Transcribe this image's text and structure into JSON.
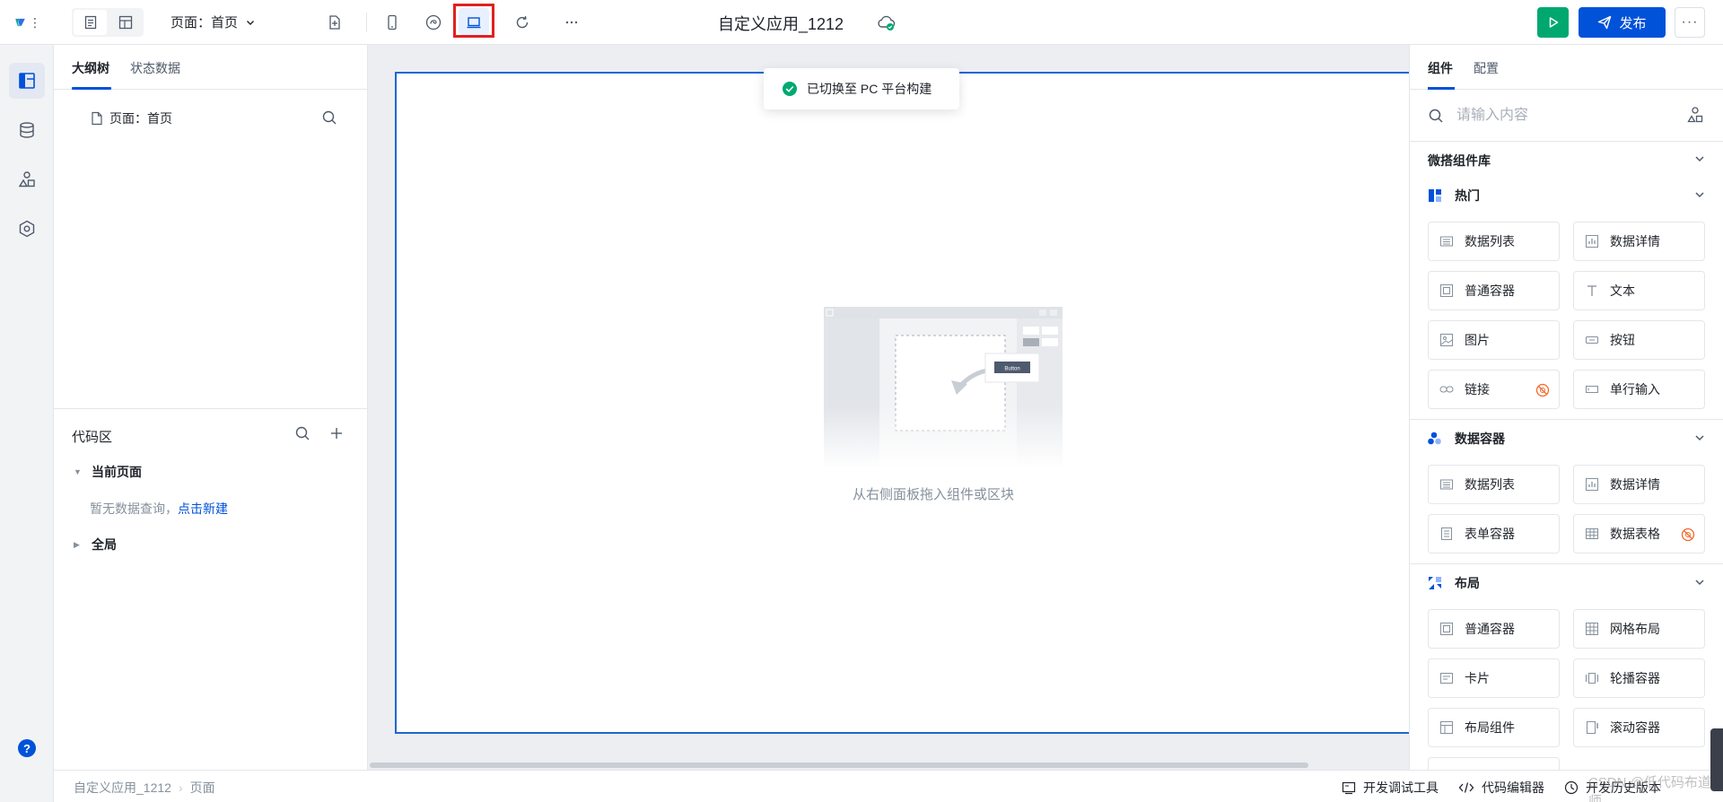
{
  "topbar": {
    "page_select": "页面：首页",
    "app_title": "自定义应用_1212",
    "publish_label": "发布",
    "more_label": "···"
  },
  "toast": {
    "message": "已切换至 PC 平台构建"
  },
  "left_panel": {
    "tabs": [
      "大纲树",
      "状态数据"
    ],
    "tree_item": "页面：首页",
    "code_area": {
      "title": "代码区",
      "current_page": "当前页面",
      "no_data": "暂无数据查询，",
      "create_link": "点击新建",
      "global": "全局"
    }
  },
  "canvas": {
    "empty_text": "从右侧面板拖入组件或区块",
    "illus_button": "Button"
  },
  "right_panel": {
    "tabs": [
      "组件",
      "配置"
    ],
    "search_placeholder": "请输入内容",
    "library": "微搭组件库",
    "sections": [
      {
        "title": "热门",
        "items": [
          "数据列表",
          "数据详情",
          "普通容器",
          "文本",
          "图片",
          "按钮",
          "链接",
          "单行输入"
        ]
      },
      {
        "title": "数据容器",
        "items": [
          "数据列表",
          "数据详情",
          "表单容器",
          "数据表格"
        ]
      },
      {
        "title": "布局",
        "items": [
          "普通容器",
          "网格布局",
          "卡片",
          "轮播容器",
          "布局组件",
          "滚动容器"
        ]
      }
    ]
  },
  "statusbar": {
    "crumbs": [
      "自定义应用_1212",
      "页面"
    ],
    "tools": [
      "开发调试工具",
      "代码编辑器",
      "开发历史版本"
    ],
    "watermark": "CSDN @低代码布道师"
  },
  "colors": {
    "primary": "#0052d9",
    "success": "#00a870",
    "highlight": "#e02020",
    "warning": "#f5682b"
  }
}
